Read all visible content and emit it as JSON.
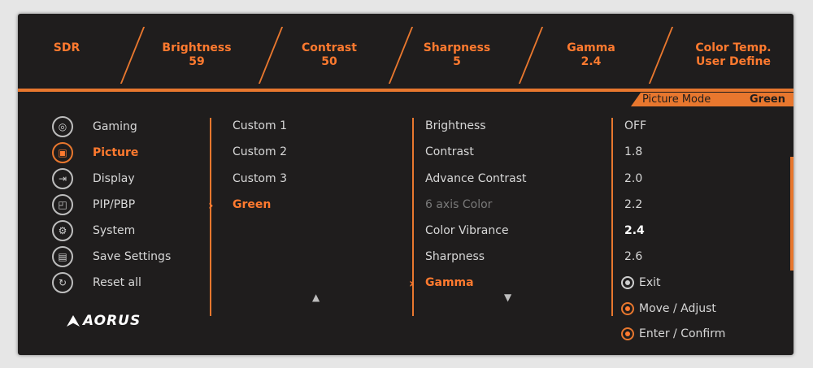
{
  "status_bar": {
    "items": [
      {
        "label": "SDR",
        "value": ""
      },
      {
        "label": "Brightness",
        "value": "59"
      },
      {
        "label": "Contrast",
        "value": "50"
      },
      {
        "label": "Sharpness",
        "value": "5"
      },
      {
        "label": "Gamma",
        "value": "2.4"
      },
      {
        "label": "Color Temp.",
        "value": "User Define"
      }
    ]
  },
  "mode": {
    "label": "Picture Mode",
    "value": "Green"
  },
  "main_menu": {
    "items": [
      {
        "label": "Gaming",
        "icon": "gamepad-icon",
        "glyph": "◎"
      },
      {
        "label": "Picture",
        "icon": "picture-icon",
        "glyph": "▣",
        "active": true
      },
      {
        "label": "Display",
        "icon": "display-input-icon",
        "glyph": "⇥"
      },
      {
        "label": "PIP/PBP",
        "icon": "pip-icon",
        "glyph": "◰"
      },
      {
        "label": "System",
        "icon": "gear-icon",
        "glyph": "⚙"
      },
      {
        "label": "Save Settings",
        "icon": "save-icon",
        "glyph": "▤"
      },
      {
        "label": "Reset all",
        "icon": "reset-icon",
        "glyph": "↻"
      }
    ]
  },
  "picture_modes": {
    "items": [
      "Custom 1",
      "Custom 2",
      "Custom 3",
      "Green"
    ],
    "active_index": 3
  },
  "picture_options": {
    "items": [
      "Brightness",
      "Contrast",
      "Advance Contrast",
      "6 axis Color",
      "Color Vibrance",
      "Sharpness",
      "Gamma"
    ],
    "active_index": 6,
    "dim_index": 3
  },
  "gamma_values": {
    "items": [
      "OFF",
      "1.8",
      "2.0",
      "2.2",
      "2.4",
      "2.6"
    ],
    "selected_index": 4
  },
  "hints": {
    "exit": "Exit",
    "move": "Move  / Adjust",
    "enter": "Enter  / Confirm"
  },
  "logo": {
    "text": "AORUS"
  },
  "colors": {
    "accent": "#e8772e",
    "background": "#1f1d1d",
    "text": "#d7d7d7"
  }
}
